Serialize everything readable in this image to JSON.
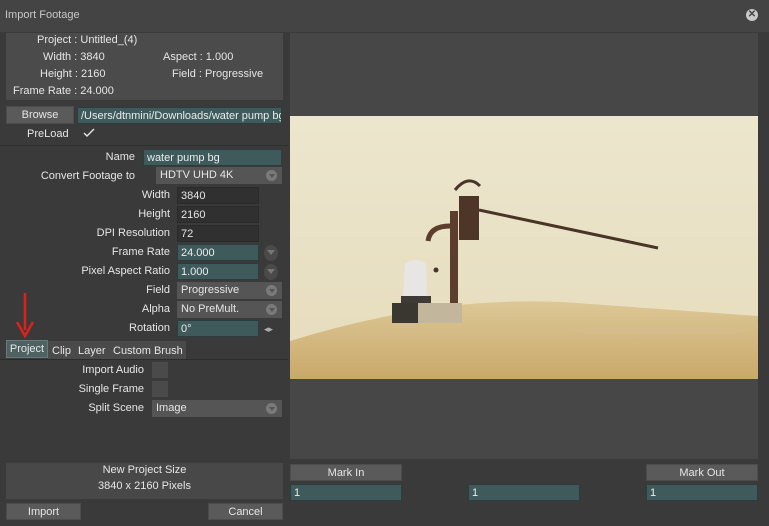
{
  "window": {
    "title": "Import Footage"
  },
  "info": {
    "project": "Project : Untitled_(4)",
    "width": "Width : 3840",
    "aspect": "Aspect : 1.000",
    "height": "Height : 2160",
    "field": "Field : Progressive",
    "frame_rate": "Frame Rate : 24.000"
  },
  "browse": {
    "label": "Browse",
    "path": "/Users/dtnmini/Downloads/water pump bg"
  },
  "preload": {
    "label": "PreLoad",
    "checked": true
  },
  "form": {
    "name_label": "Name",
    "name_value": "water pump bg",
    "convert_label": "Convert Footage to",
    "convert_value": "HDTV UHD 4K",
    "width_label": "Width",
    "width_value": "3840",
    "height_label": "Height",
    "height_value": "2160",
    "dpi_label": "DPI Resolution",
    "dpi_value": "72",
    "framerate_label": "Frame Rate",
    "framerate_value": "24.000",
    "par_label": "Pixel Aspect Ratio",
    "par_value": "1.000",
    "field_label": "Field",
    "field_value": "Progressive",
    "alpha_label": "Alpha",
    "alpha_value": "No PreMult.",
    "rotation_label": "Rotation",
    "rotation_value": "0°"
  },
  "tabs": {
    "project": "Project",
    "clip": "Clip",
    "layer": "Layer",
    "custom_brush": "Custom Brush"
  },
  "project_tab": {
    "import_audio": "Import Audio",
    "single_frame": "Single Frame",
    "split_scene_label": "Split Scene",
    "split_scene_value": "Image"
  },
  "new_size": {
    "title": "New Project Size",
    "value": "3840 x 2160 Pixels"
  },
  "actions": {
    "import": "Import",
    "cancel": "Cancel"
  },
  "marks": {
    "mark_in": "Mark In",
    "mark_out": "Mark Out",
    "in_value": "1",
    "mid_value": "1",
    "out_value": "1"
  },
  "colors": {
    "accent_field": "#3f5a5a",
    "arrow": "#e0201a",
    "background": "#3a3a3a"
  },
  "icons": {
    "close": "close-icon",
    "check": "check-icon",
    "dropdown": "chevron-down-icon",
    "annotation": "red-arrow-icon"
  }
}
